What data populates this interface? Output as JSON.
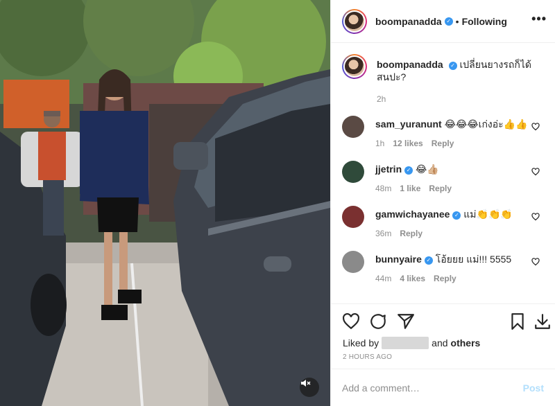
{
  "post": {
    "author": "boompanadda",
    "follow_state": "Following",
    "separator": "•",
    "caption": "เปลี่ยนยางรถก็ได้ สนปะ?",
    "caption_time": "2h",
    "verified_glyph": "✓"
  },
  "comments": [
    {
      "user": "sam_yuranunt",
      "text": "😂😂😂เก่งอ่ะ👍👍",
      "time": "1h",
      "likes": "12 likes",
      "reply": "Reply",
      "verified": false,
      "avatar_color": "#5a4a44"
    },
    {
      "user": "jjetrin",
      "text": "😂👍🏼",
      "time": "48m",
      "likes": "1 like",
      "reply": "Reply",
      "verified": true,
      "avatar_color": "#2f4a3a"
    },
    {
      "user": "gamwichayanee",
      "text": "แม่👏👏👏",
      "time": "36m",
      "likes": "",
      "reply": "Reply",
      "verified": true,
      "avatar_color": "#7a3030"
    },
    {
      "user": "bunnyaire",
      "text": "โอ้ยยย แม่!!! 5555",
      "time": "44m",
      "likes": "4 likes",
      "reply": "Reply",
      "verified": true,
      "avatar_color": "#8a8a8a"
    }
  ],
  "actions": {
    "liked_by_prefix": "Liked by",
    "liked_by_suffix_and": "and",
    "liked_by_others": "others",
    "timestamp": "2 HOURS AGO"
  },
  "composer": {
    "placeholder": "Add a comment…",
    "post_label": "Post"
  },
  "icons": {
    "more": "more-options-icon",
    "like": "heart-icon",
    "comment": "comment-icon",
    "share": "share-icon",
    "save": "bookmark-icon",
    "download": "download-icon",
    "mute": "muted-speaker-icon"
  },
  "colors": {
    "verified": "#3897f0",
    "post_disabled": "#b2dffc",
    "meta_gray": "#8e8e8e"
  }
}
